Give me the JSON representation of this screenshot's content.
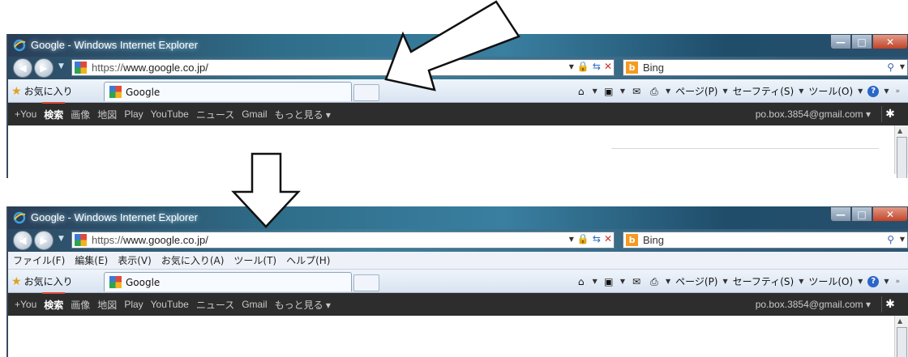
{
  "title": "Google - Windows Internet Explorer",
  "address": {
    "protocol": "https://",
    "host": "www.google.co.jp/"
  },
  "search": {
    "engine": "Bing"
  },
  "menubar": [
    "ファイル(F)",
    "編集(E)",
    "表示(V)",
    "お気に入り(A)",
    "ツール(T)",
    "ヘルプ(H)"
  ],
  "favorites_label": "お気に入り",
  "tab_label": "Google",
  "commands_top": {
    "page": "ページ(P)",
    "safety": "セーフティ(S)",
    "tools": "ツール(O)"
  },
  "commands_bottom": {
    "page": "ページ(P)",
    "safety": "セーフティ(S)",
    "tools": "ツール(O)"
  },
  "google_bar": {
    "items": [
      "+You",
      "検索",
      "画像",
      "地図",
      "Play",
      "YouTube",
      "ニュース",
      "Gmail",
      "もっと見る ▾"
    ],
    "active": "検索",
    "account": "po.box.3854@gmail.com ▾"
  },
  "icons": {
    "back": "back-arrow-icon",
    "forward": "forward-arrow-icon",
    "lock": "lock-icon",
    "refresh": "refresh-icon",
    "stop": "stop-icon",
    "home": "home-icon",
    "feeds": "feeds-icon",
    "mail": "mail-icon",
    "print": "print-icon",
    "help": "help-icon",
    "gear": "gear-icon",
    "favorites": "favorites-star-icon"
  },
  "colors": {
    "gbar_bg": "#2d2d2d",
    "gbar_active_accent": "#dd4b39",
    "ie_title_bg": "#2f6e8a"
  }
}
